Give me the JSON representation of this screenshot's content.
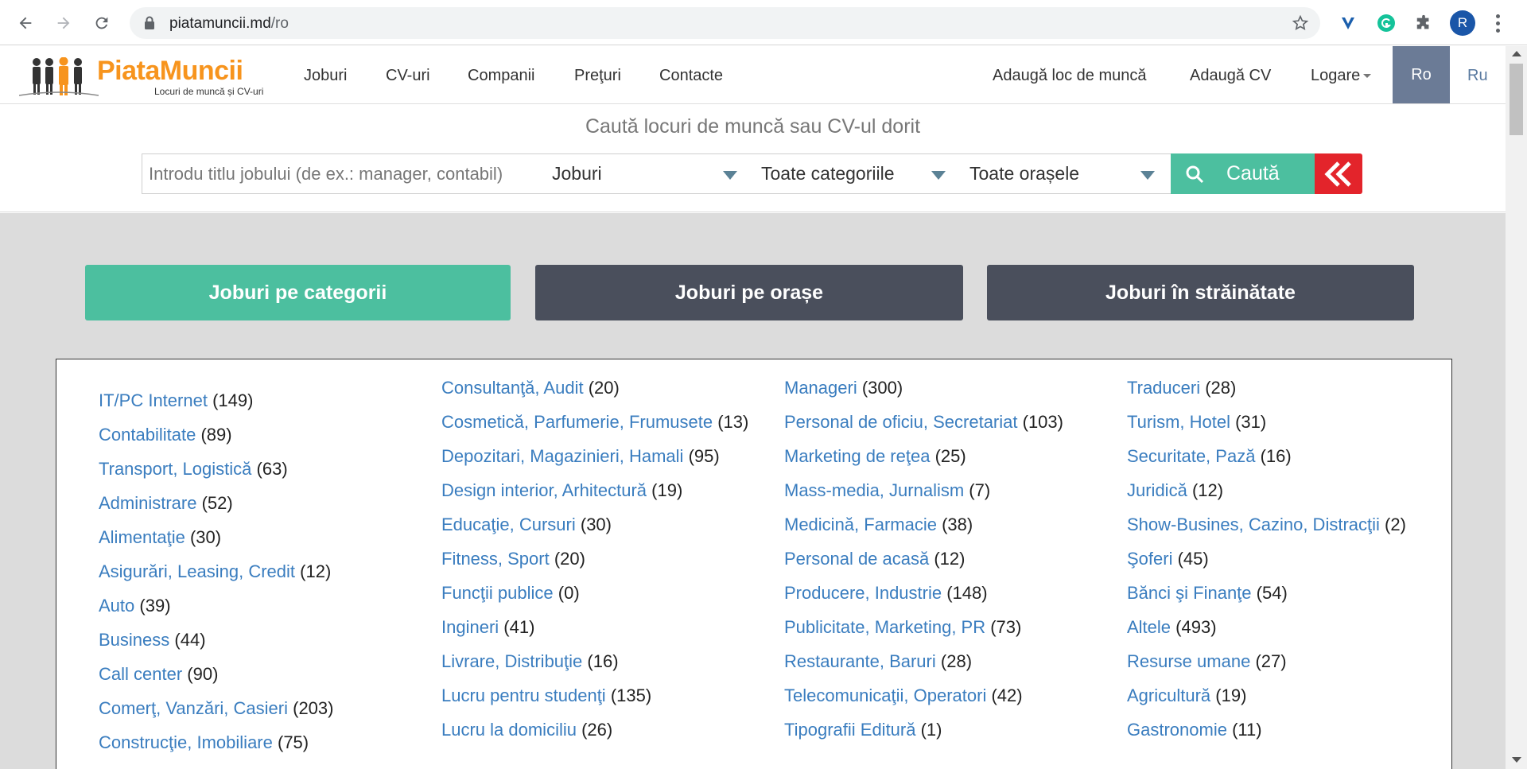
{
  "browser": {
    "url_host": "piatamuncii.md",
    "url_path": "/ro",
    "avatar_letter": "R"
  },
  "header": {
    "logo_text": "PiataMuncii",
    "logo_sub": "Locuri de muncă și CV-uri",
    "nav": [
      "Joburi",
      "CV-uri",
      "Companii",
      "Preţuri",
      "Contacte"
    ],
    "right_nav": [
      "Adaugă loc de muncă",
      "Adaugă CV",
      "Logare"
    ],
    "lang_active": "Ro",
    "lang_other": "Ru"
  },
  "search": {
    "title": "Caută locuri de muncă sau CV-ul dorit",
    "placeholder": "Introdu titlu jobului (de ex.: manager, contabil)",
    "type": "Joburi",
    "category": "Toate categoriile",
    "city": "Toate orașele",
    "button": "Caută"
  },
  "tabs": [
    "Joburi pe categorii",
    "Joburi pe orașe",
    "Joburi în străinătate"
  ],
  "colors": {
    "accent": "#4cbf9f",
    "dark_tab": "#4a4f5c",
    "link": "#3a7dbf",
    "red": "#e3242b",
    "lang_active": "#6b7b96"
  },
  "categories": {
    "col1": [
      {
        "name": "IT/PC Internet",
        "count": "(149)"
      },
      {
        "name": "Contabilitate",
        "count": "(89)"
      },
      {
        "name": "Transport, Logistică",
        "count": "(63)"
      },
      {
        "name": "Administrare",
        "count": "(52)"
      },
      {
        "name": "Alimentaţie",
        "count": "(30)"
      },
      {
        "name": "Asigurări, Leasing, Credit",
        "count": "(12)"
      },
      {
        "name": "Auto",
        "count": "(39)"
      },
      {
        "name": "Business",
        "count": "(44)"
      },
      {
        "name": "Call center",
        "count": "(90)"
      },
      {
        "name": "Comerţ, Vanzări, Casieri",
        "count": "(203)"
      },
      {
        "name": "Construcţie, Imobiliare",
        "count": "(75)"
      }
    ],
    "col2": [
      {
        "name": "Consultanţă, Audit",
        "count": "(20)"
      },
      {
        "name": "Cosmetică, Parfumerie, Frumusete",
        "count": "(13)"
      },
      {
        "name": "Depozitari, Magazinieri, Hamali",
        "count": "(95)"
      },
      {
        "name": "Design interior, Arhitectură",
        "count": "(19)"
      },
      {
        "name": "Educaţie, Cursuri",
        "count": "(30)"
      },
      {
        "name": "Fitness, Sport",
        "count": "(20)"
      },
      {
        "name": "Funcţii publice",
        "count": "(0)"
      },
      {
        "name": "Ingineri",
        "count": "(41)"
      },
      {
        "name": "Livrare, Distribuţie",
        "count": "(16)"
      },
      {
        "name": "Lucru pentru studenţi",
        "count": "(135)"
      },
      {
        "name": "Lucru la domiciliu",
        "count": "(26)"
      }
    ],
    "col3": [
      {
        "name": "Manageri",
        "count": "(300)"
      },
      {
        "name": "Personal de oficiu, Secretariat",
        "count": "(103)"
      },
      {
        "name": "Marketing de reţea",
        "count": "(25)"
      },
      {
        "name": "Mass-media, Jurnalism",
        "count": "(7)"
      },
      {
        "name": "Medicină, Farmacie",
        "count": "(38)"
      },
      {
        "name": "Personal de acasă",
        "count": "(12)"
      },
      {
        "name": "Producere, Industrie",
        "count": "(148)"
      },
      {
        "name": "Publicitate, Marketing, PR",
        "count": "(73)"
      },
      {
        "name": "Restaurante, Baruri",
        "count": "(28)"
      },
      {
        "name": "Telecomunicaţii, Operatori",
        "count": "(42)"
      },
      {
        "name": "Tipografii Editură",
        "count": "(1)"
      }
    ],
    "col4": [
      {
        "name": "Traduceri",
        "count": "(28)"
      },
      {
        "name": "Turism, Hotel",
        "count": "(31)"
      },
      {
        "name": "Securitate, Pază",
        "count": "(16)"
      },
      {
        "name": "Juridică",
        "count": "(12)"
      },
      {
        "name": "Show-Busines, Cazino, Distracţii",
        "count": "(2)"
      },
      {
        "name": "Şoferi",
        "count": "(45)"
      },
      {
        "name": "Bănci şi Finanţe",
        "count": "(54)"
      },
      {
        "name": "Altele",
        "count": "(493)"
      },
      {
        "name": "Resurse umane",
        "count": "(27)"
      },
      {
        "name": "Agricultură",
        "count": "(19)"
      },
      {
        "name": "Gastronomie",
        "count": "(11)"
      }
    ]
  }
}
